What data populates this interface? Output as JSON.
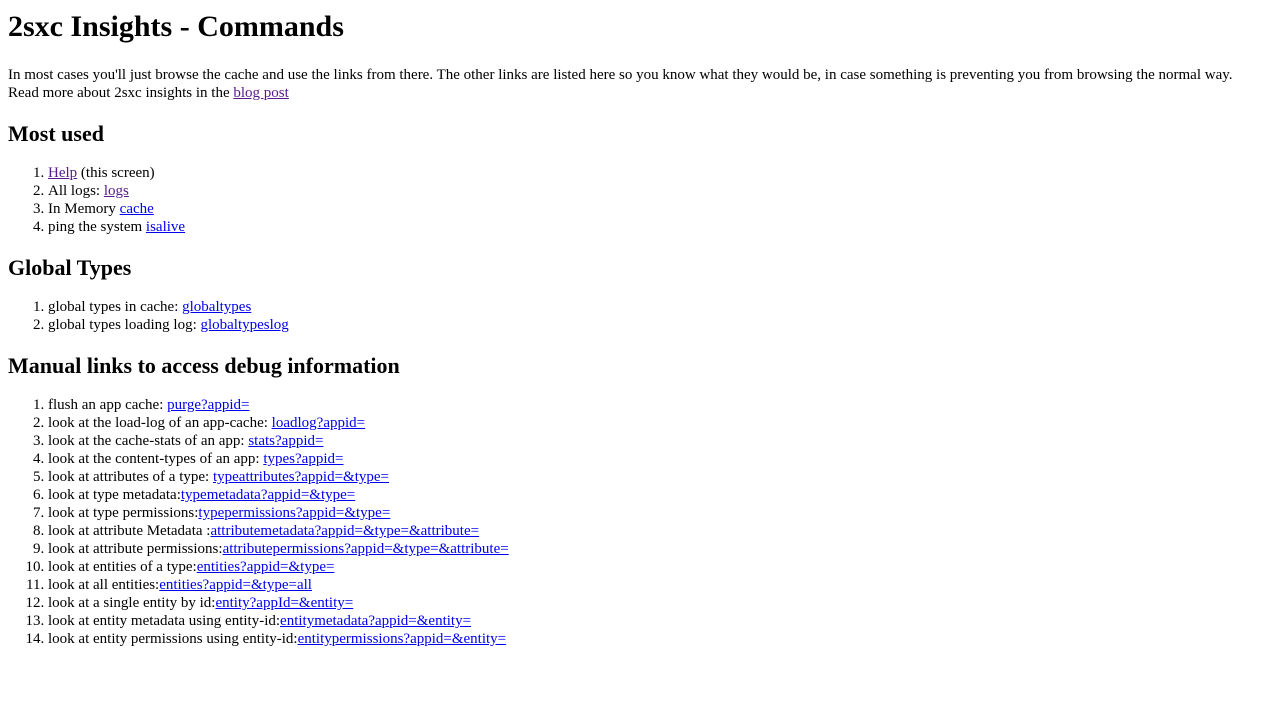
{
  "page": {
    "title": "2sxc Insights - Commands",
    "intro_text": "In most cases you'll just browse the cache and use the links from there. The other links are listed here so you know what they would be, in case something is preventing you from browsing the normal way. Read more about 2sxc insights in the ",
    "intro_link": "blog post"
  },
  "sections": {
    "most_used": {
      "heading": "Most used",
      "items": [
        {
          "prefix": "",
          "link": "Help",
          "suffix": " (this screen)"
        },
        {
          "prefix": "All logs: ",
          "link": "logs",
          "suffix": ""
        },
        {
          "prefix": "In Memory ",
          "link": "cache",
          "suffix": ""
        },
        {
          "prefix": "ping the system ",
          "link": "isalive",
          "suffix": ""
        }
      ]
    },
    "global_types": {
      "heading": "Global Types",
      "items": [
        {
          "prefix": "global types in cache: ",
          "link": "globaltypes"
        },
        {
          "prefix": "global types loading log: ",
          "link": "globaltypeslog"
        }
      ]
    },
    "manual_links": {
      "heading": "Manual links to access debug information",
      "items": [
        {
          "prefix": "flush an app cache: ",
          "link": "purge?appid="
        },
        {
          "prefix": "look at the load-log of an app-cache: ",
          "link": "loadlog?appid="
        },
        {
          "prefix": "look at the cache-stats of an app: ",
          "link": "stats?appid="
        },
        {
          "prefix": "look at the content-types of an app: ",
          "link": "types?appid="
        },
        {
          "prefix": "look at attributes of a type: ",
          "link": "typeattributes?appid=&type="
        },
        {
          "prefix": "look at type metadata:",
          "link": "typemetadata?appid=&type="
        },
        {
          "prefix": "look at type permissions:",
          "link": "typepermissions?appid=&type="
        },
        {
          "prefix": "look at attribute Metadata :",
          "link": "attributemetadata?appid=&type=&attribute="
        },
        {
          "prefix": "look at attribute permissions:",
          "link": "attributepermissions?appid=&type=&attribute="
        },
        {
          "prefix": "look at entities of a type:",
          "link": "entities?appid=&type="
        },
        {
          "prefix": "look at all entities:",
          "link": "entities?appid=&type=all"
        },
        {
          "prefix": "look at a single entity by id:",
          "link": "entity?appId=&entity="
        },
        {
          "prefix": "look at entity metadata using entity-id:",
          "link": "entitymetadata?appid=&entity="
        },
        {
          "prefix": "look at entity permissions using entity-id:",
          "link": "entitypermissions?appid=&entity="
        }
      ]
    }
  },
  "colors": {
    "link": "#0000ee",
    "visited_link": "#551a8b",
    "text": "#000000",
    "background": "#ffffff"
  }
}
